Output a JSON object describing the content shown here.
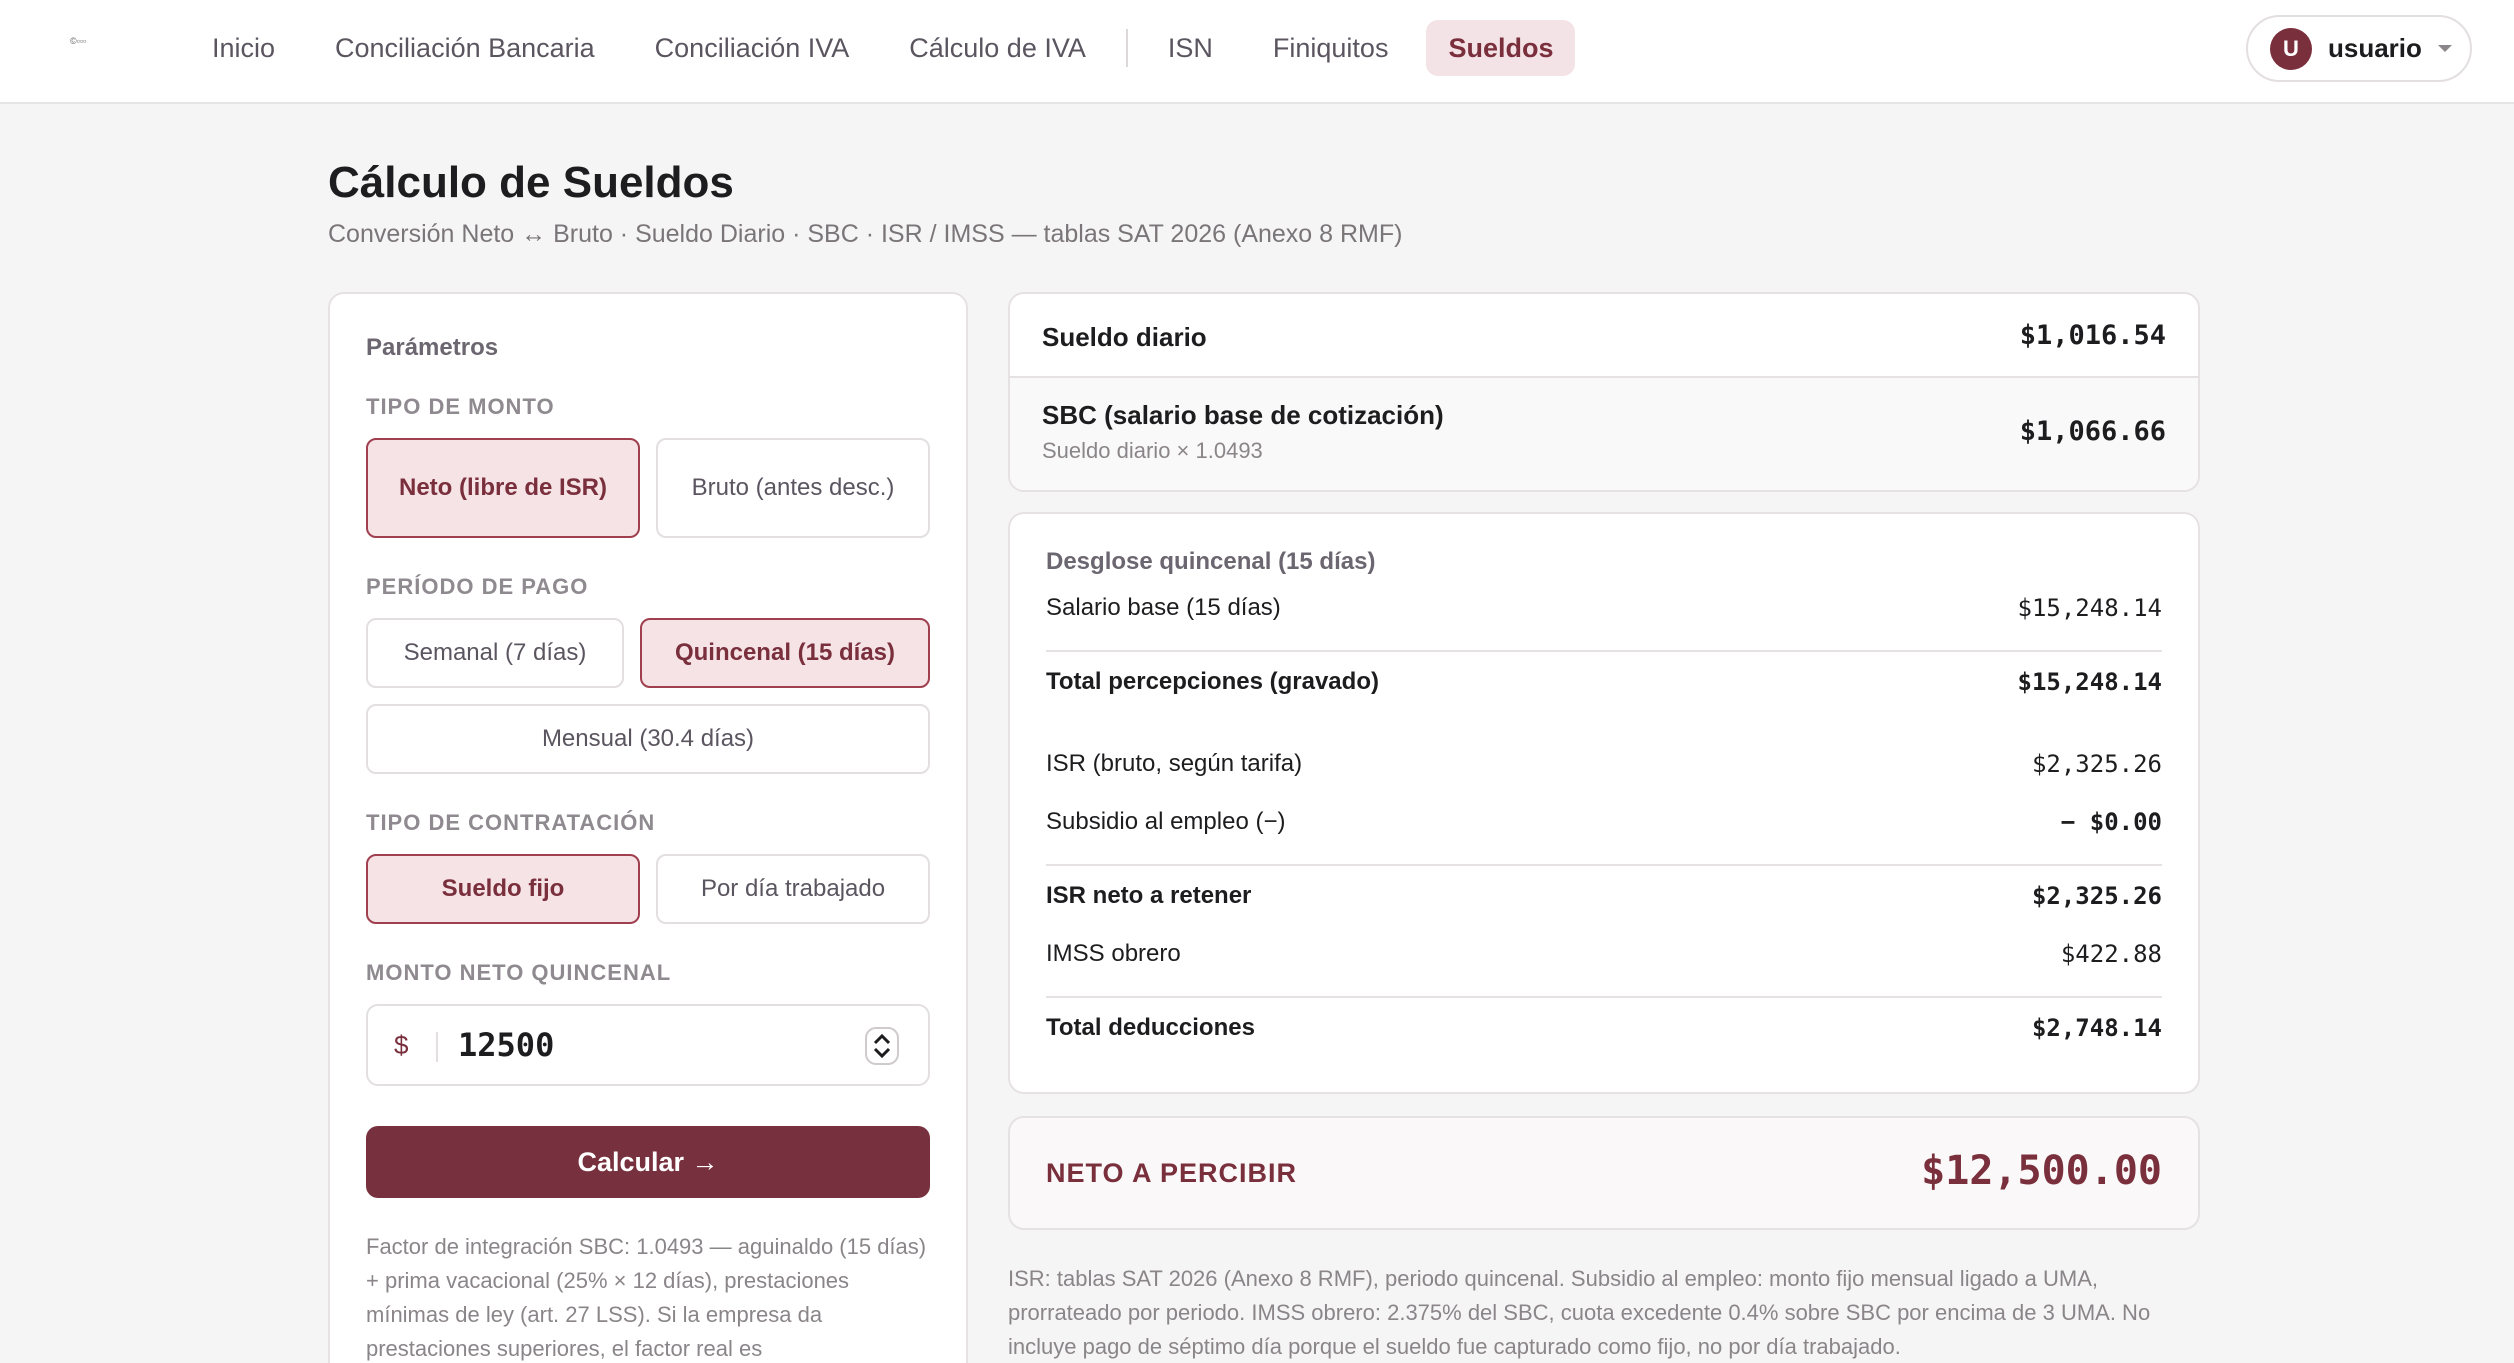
{
  "nav": {
    "logo_text": "©▫▫▫",
    "items": [
      {
        "label": "Inicio"
      },
      {
        "label": "Conciliación Bancaria"
      },
      {
        "label": "Conciliación IVA"
      },
      {
        "label": "Cálculo de IVA"
      },
      {
        "label": "ISN"
      },
      {
        "label": "Finiquitos"
      },
      {
        "label": "Sueldos",
        "active": true
      }
    ],
    "user": {
      "initial": "U",
      "name": "usuario"
    }
  },
  "header": {
    "title": "Cálculo de Sueldos",
    "subtitle": "Conversión Neto ↔ Bruto · Sueldo Diario · SBC · ISR / IMSS — tablas SAT 2026 (Anexo 8 RMF)"
  },
  "params": {
    "title": "Parámetros",
    "tipo_monto": {
      "label": "TIPO DE MONTO",
      "options": [
        "Neto (libre de ISR)",
        "Bruto (antes desc.)"
      ],
      "selected": "Neto (libre de ISR)"
    },
    "periodo": {
      "label": "PERÍODO DE PAGO",
      "options": [
        "Semanal (7 días)",
        "Quincenal (15 días)",
        "Mensual (30.4 días)"
      ],
      "selected": "Quincenal (15 días)"
    },
    "contratacion": {
      "label": "TIPO DE CONTRATACIÓN",
      "options": [
        "Sueldo fijo",
        "Por día trabajado"
      ],
      "selected": "Sueldo fijo"
    },
    "monto": {
      "label": "MONTO NETO QUINCENAL",
      "symbol": "$",
      "value": "12500"
    },
    "calc_button": "Calcular →",
    "note": "Factor de integración SBC: 1.0493 — aguinaldo (15 días) + prima vacacional (25% × 12 días), prestaciones mínimas de ley (art. 27 LSS). Si la empresa da prestaciones superiores, el factor real es"
  },
  "results": {
    "sueldo_diario": {
      "label": "Sueldo diario",
      "value": "$1,016.54"
    },
    "sbc": {
      "label": "SBC (salario base de cotización)",
      "sub": "Sueldo diario × 1.0493",
      "value": "$1,066.66"
    },
    "desglose": {
      "title": "Desglose quincenal (15 días)",
      "rows": [
        {
          "label": "Salario base (15 días)",
          "value": "$15,248.14"
        },
        {
          "label": "Total percepciones (gravado)",
          "value": "$15,248.14"
        },
        {
          "label": "ISR (bruto, según tarifa)",
          "value": "$2,325.26"
        },
        {
          "label": "Subsidio al empleo (−)",
          "value": "− $0.00"
        },
        {
          "label": "ISR neto a retener",
          "value": "$2,325.26"
        },
        {
          "label": "IMSS obrero",
          "value": "$422.88"
        },
        {
          "label": "Total deducciones",
          "value": "$2,748.14"
        }
      ]
    },
    "neto": {
      "label": "NETO A PERCIBIR",
      "value": "$12,500.00"
    },
    "footnote": "ISR: tablas SAT 2026 (Anexo 8 RMF), periodo quincenal. Subsidio al empleo: monto fijo mensual ligado a UMA, prorrateado por periodo. IMSS obrero: 2.375% del SBC, cuota excedente 0.4% sobre SBC por encima de 3 UMA. No incluye pago de séptimo día porque el sueldo fue capturado como fijo, no por día trabajado."
  },
  "colors": {
    "accent": "#77303d",
    "accent_soft": "#f5e3e6"
  }
}
